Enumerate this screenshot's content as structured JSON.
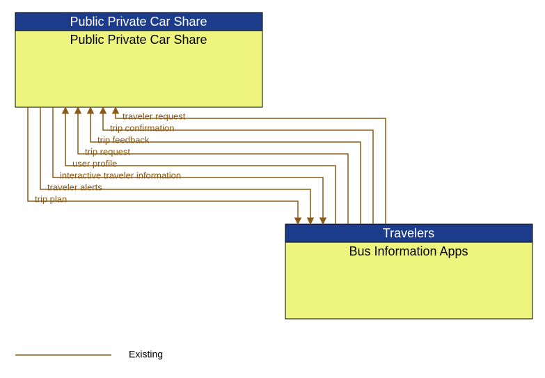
{
  "boxes": {
    "a": {
      "header": "Public Private Car Share",
      "title": "Public Private Car Share"
    },
    "b": {
      "header": "Travelers",
      "title": "Bus Information Apps"
    }
  },
  "flows": [
    {
      "label": "traveler request",
      "dir": "b_to_a"
    },
    {
      "label": "trip confirmation",
      "dir": "b_to_a"
    },
    {
      "label": "trip feedback",
      "dir": "b_to_a"
    },
    {
      "label": "trip request",
      "dir": "b_to_a"
    },
    {
      "label": "user profile",
      "dir": "b_to_a"
    },
    {
      "label": "interactive traveler information",
      "dir": "a_to_b"
    },
    {
      "label": "traveler alerts",
      "dir": "a_to_b"
    },
    {
      "label": "trip plan",
      "dir": "a_to_b"
    }
  ],
  "legend": {
    "existing": "Existing"
  },
  "colors": {
    "flow": "#8a5a17",
    "header_bg": "#1d3b8b",
    "body_bg": "#eef57f"
  }
}
